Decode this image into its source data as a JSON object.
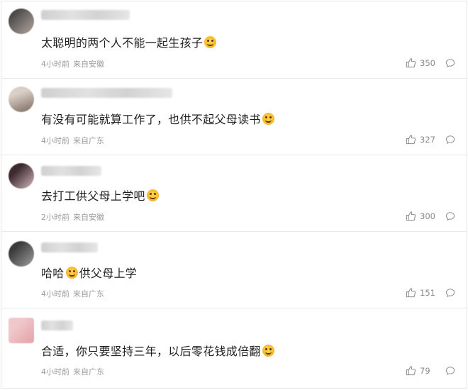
{
  "comments": [
    {
      "text": "太聪明的两个人不能一起生孩子",
      "emoji": "smirk-emoji",
      "time": "4小时前",
      "location": "来自安徽",
      "likes": "350",
      "avatar_colors": [
        "#4a4a4a",
        "#9a8f88"
      ]
    },
    {
      "text": "有没有可能就算工作了，也供不起父母读书",
      "emoji": "laughing-emoji",
      "time": "4小时前",
      "location": "来自广东",
      "likes": "327",
      "avatar_colors": [
        "#d9cfc7",
        "#8f7f74"
      ]
    },
    {
      "text": "去打工供父母上学吧",
      "emoji": "smirk-emoji",
      "time": "2小时前",
      "location": "来自安徽",
      "likes": "300",
      "avatar_colors": [
        "#3c2a2e",
        "#b39aa0"
      ]
    },
    {
      "text": "哈哈",
      "text_after": "供父母上学",
      "emoji": "laughing-emoji",
      "time": "4小时前",
      "location": "来自广东",
      "likes": "151",
      "avatar_colors": [
        "#3a3a3a",
        "#8a8a8a"
      ]
    },
    {
      "text": "合适，你只要坚持三年，以后零花钱成倍翻",
      "emoji": "smirk-emoji",
      "time": "4小时前",
      "location": "来自广东",
      "likes": "79",
      "avatar_colors": [
        "#f0c8cc",
        "#e6a9ae"
      ]
    }
  ]
}
